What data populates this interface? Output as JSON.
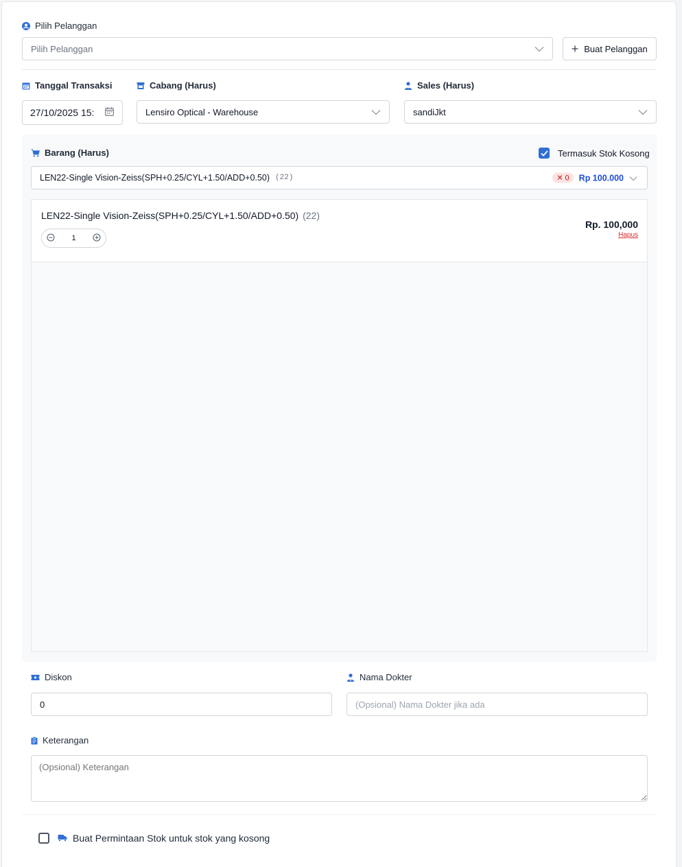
{
  "customer": {
    "label": "Pilih Pelanggan",
    "placeholder": "Pilih Pelanggan",
    "create_button": "Buat Pelanggan"
  },
  "date": {
    "label": "Tanggal Transaksi",
    "value": "27/10/2025 15:"
  },
  "branch": {
    "label": "Cabang (Harus)",
    "value": "Lensiro Optical - Warehouse"
  },
  "sales": {
    "label": "Sales (Harus)",
    "value": "sandiJkt"
  },
  "items": {
    "label": "Barang (Harus)",
    "include_empty_stock_label": "Termasuk Stok Kosong",
    "include_empty_stock_checked": true,
    "select": {
      "name": "LEN22-Single Vision-Zeiss(SPH+0.25/CYL+1.50/ADD+0.50)",
      "code": "(22)",
      "stock_badge": "0",
      "price": "Rp 100.000"
    },
    "cart": [
      {
        "name": "LEN22-Single Vision-Zeiss(SPH+0.25/CYL+1.50/ADD+0.50)",
        "code": "(22)",
        "quantity": "1",
        "price": "Rp. 100,000",
        "delete_label": "Hapus"
      }
    ]
  },
  "discount": {
    "label": "Diskon",
    "value": "0"
  },
  "doctor": {
    "label": "Nama Dokter",
    "placeholder": "(Opsional) Nama Dokter jika ada"
  },
  "notes": {
    "label": "Keterangan",
    "placeholder": "(Opsional) Keterangan"
  },
  "stock_request": {
    "label": "Buat Permintaan Stok untuk stok yang kosong",
    "checked": false
  },
  "colors": {
    "accent": "#2f6fd6",
    "price_blue": "#1d4ed8",
    "danger": "#dc2626"
  }
}
